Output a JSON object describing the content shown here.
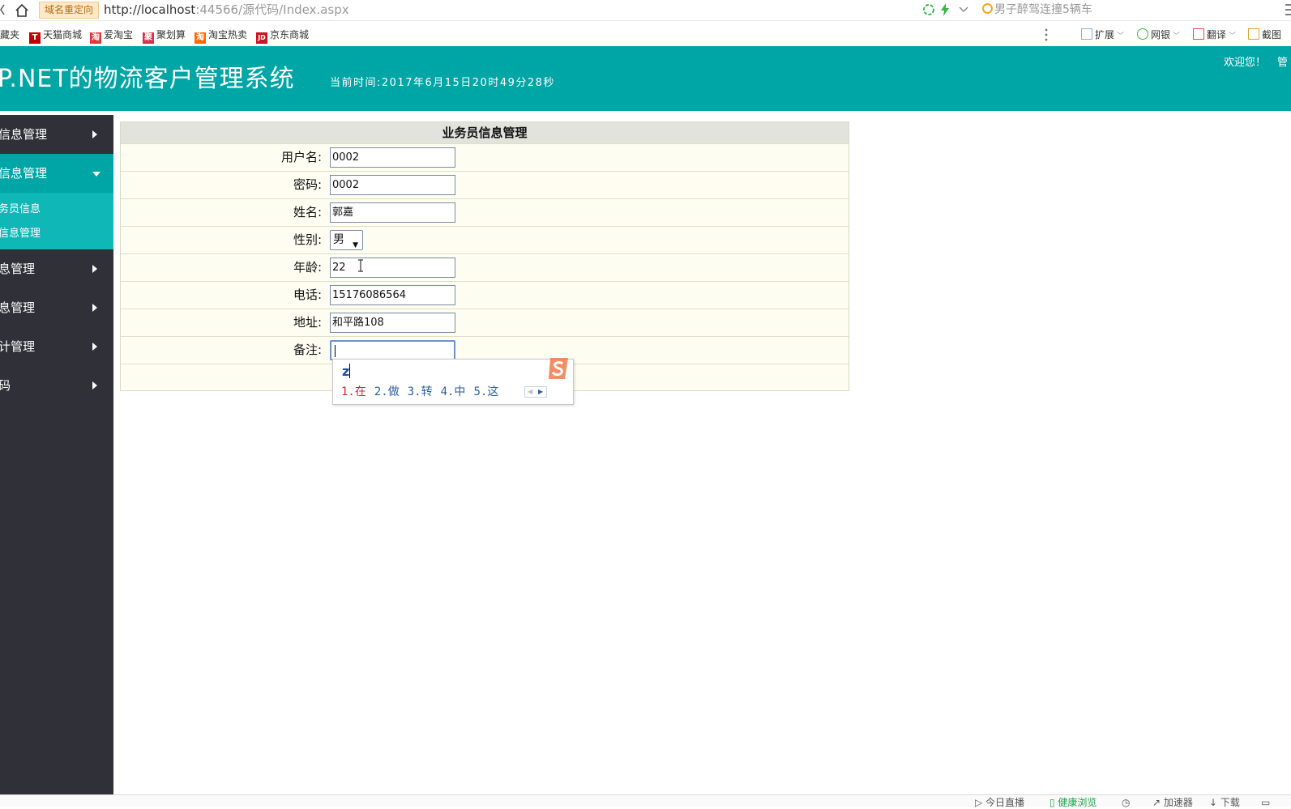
{
  "browser": {
    "redirect_badge": "域名重定向",
    "url_host": "http://localhost",
    "url_rest": ":44566/源代码/Index.aspx",
    "search_suggestion": "男子醉驾连撞5辆车",
    "bookmarks": [
      {
        "label": "藏夹",
        "icon": "folder-icon"
      },
      {
        "label": "天猫商城",
        "icon": "tmall-icon",
        "icon_char": "T",
        "color": "#c40000"
      },
      {
        "label": "爱淘宝",
        "icon": "aitaobao-icon",
        "icon_char": "淘",
        "color": "#e4393c"
      },
      {
        "label": "聚划算",
        "icon": "juhuasuan-icon",
        "icon_char": "聚",
        "color": "#d9304b"
      },
      {
        "label": "淘宝热卖",
        "icon": "taobao-hot-icon",
        "icon_char": "淘",
        "color": "#ff6a00"
      },
      {
        "label": "京东商城",
        "icon": "jd-icon",
        "icon_char": "JD",
        "color": "#c81623"
      }
    ],
    "toolbar_right": [
      "扩展",
      "网银",
      "翻译",
      "截图"
    ]
  },
  "header": {
    "title": "P.NET的物流客户管理系统",
    "clock": "当前时间:2017年6月15日20时49分28秒",
    "welcome": "欢迎您！",
    "user": "管"
  },
  "sidebar": {
    "items": [
      {
        "label": "信息管理",
        "open": false
      },
      {
        "label": "信息管理",
        "open": true
      },
      {
        "label": "息管理",
        "open": false
      },
      {
        "label": "息管理",
        "open": false
      },
      {
        "label": "计管理",
        "open": false
      },
      {
        "label": "码",
        "open": false
      }
    ],
    "sub_items": [
      "务员信息",
      "信息管理"
    ]
  },
  "form": {
    "caption": "业务员信息管理",
    "fields": [
      {
        "label": "用户名:",
        "value": "0002"
      },
      {
        "label": "密码:",
        "value": "0002"
      },
      {
        "label": "姓名:",
        "value": "郭嘉"
      },
      {
        "label": "性别:",
        "value": "男"
      },
      {
        "label": "年龄:",
        "value": "22"
      },
      {
        "label": "电话:",
        "value": "15176086564"
      },
      {
        "label": "地址:",
        "value": "和平路108"
      },
      {
        "label": "备注:",
        "value": ""
      }
    ]
  },
  "ime": {
    "pinyin": "z",
    "candidates": [
      "1.在",
      "2.做",
      "3.转",
      "4.中",
      "5.这"
    ]
  },
  "statusbar": {
    "items": [
      "今日直播",
      "健康浏览",
      "加速器",
      "下载"
    ]
  }
}
